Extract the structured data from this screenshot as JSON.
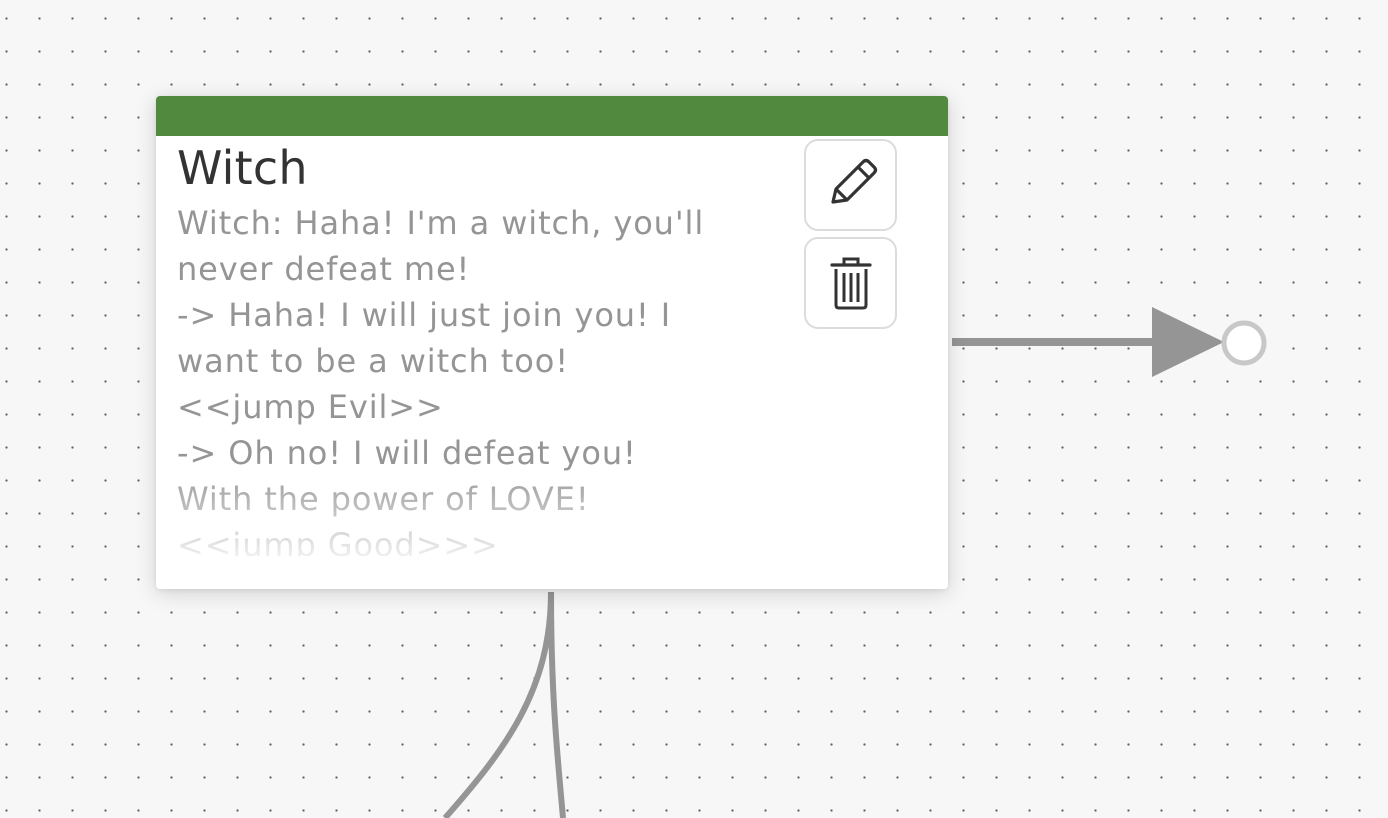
{
  "canvas": {
    "background": "#f7f7f7",
    "dot_color": "#5f5f5f",
    "connector_color": "#959595",
    "port_color": "#c8c8c8"
  },
  "node": {
    "title": "Witch",
    "header_color": "#518a3f",
    "body_lines": [
      "Witch: Haha! I'm a witch, you'll",
      "never defeat me!",
      "-> Haha! I will just join you! I",
      "want to be a witch too!",
      "<<jump Evil>>",
      "-> Oh no! I will defeat you!",
      "With the power of LOVE!",
      "<<jump Good>>>"
    ],
    "edit_icon": "pencil-icon",
    "delete_icon": "trash-icon"
  }
}
